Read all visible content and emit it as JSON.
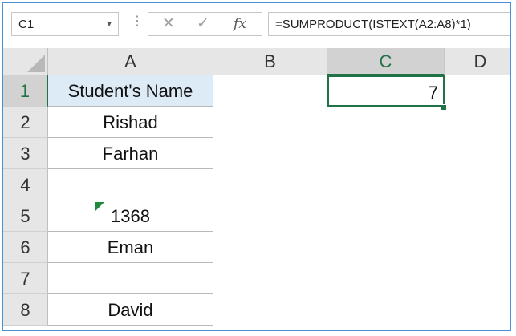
{
  "formula_bar": {
    "name_box": "C1",
    "formula": "=SUMPRODUCT(ISTEXT(A2:A8)*1)",
    "cancel_glyph": "✕",
    "enter_glyph": "✓",
    "fx_glyph": "fx"
  },
  "columns": [
    "A",
    "B",
    "C",
    "D"
  ],
  "rows": [
    "1",
    "2",
    "3",
    "4",
    "5",
    "6",
    "7",
    "8"
  ],
  "cells": {
    "A1": "Student's Name",
    "A2": "Rishad",
    "A3": "Farhan",
    "A4": "",
    "A5": "1368",
    "A6": "Eman",
    "A7": "",
    "A8": "David",
    "C1": "7"
  },
  "colors": {
    "accent": "#217346",
    "header_fill": "#ddebf7",
    "frame_border": "#4a90d9"
  }
}
